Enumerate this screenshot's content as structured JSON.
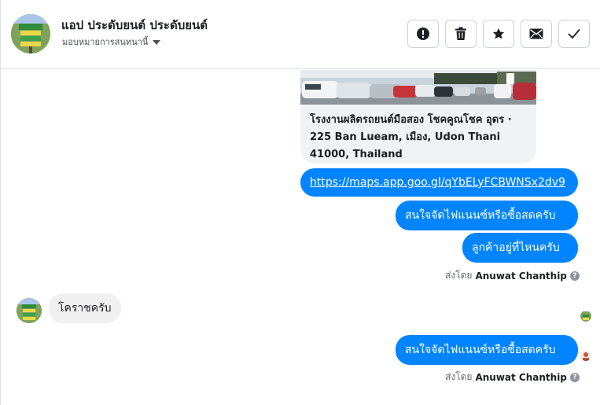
{
  "header": {
    "page_name": "แอป ประดับยนต์ ประดับยนต์",
    "assign_label": "มอบหมายการสนทนานี้",
    "actions": [
      {
        "name": "report-spam-button",
        "icon": "exclamation-circle-icon"
      },
      {
        "name": "delete-button",
        "icon": "trash-icon"
      },
      {
        "name": "star-button",
        "icon": "star-icon"
      },
      {
        "name": "mark-unread-button",
        "icon": "envelope-icon"
      },
      {
        "name": "mark-done-button",
        "icon": "checkmark-icon"
      }
    ]
  },
  "messages": {
    "location_card": {
      "caption": "โรงงานผลิตรถยนต์มือสอง โชคคูณโชค อุดร · 225 Ban Lueam, เมือง, Udon Thani 41000, Thailand"
    },
    "link": "https://maps.app.goo.gl/qYbELyFCBWNSx2dv9",
    "out_1": "สนใจจัดไฟแนนซ์หรือซื้อสดครับ",
    "out_2": "ลูกค้าอยู่ที่ไหนครับ",
    "sent_by_prefix": "ส่งโดย",
    "sent_by_name": "Anuwat Chanthip",
    "in_1": "โคราชครับ",
    "out_3": "สนใจจัดไฟแนนซ์หรือซื้อสดครับ",
    "sent_by_prefix_2": "ส่งโดย",
    "sent_by_name_2": "Anuwat Chanthip"
  },
  "colors": {
    "outgoing_bubble": "#0084ff",
    "incoming_bubble": "#f1f0f0",
    "border": "#dddfe2"
  }
}
